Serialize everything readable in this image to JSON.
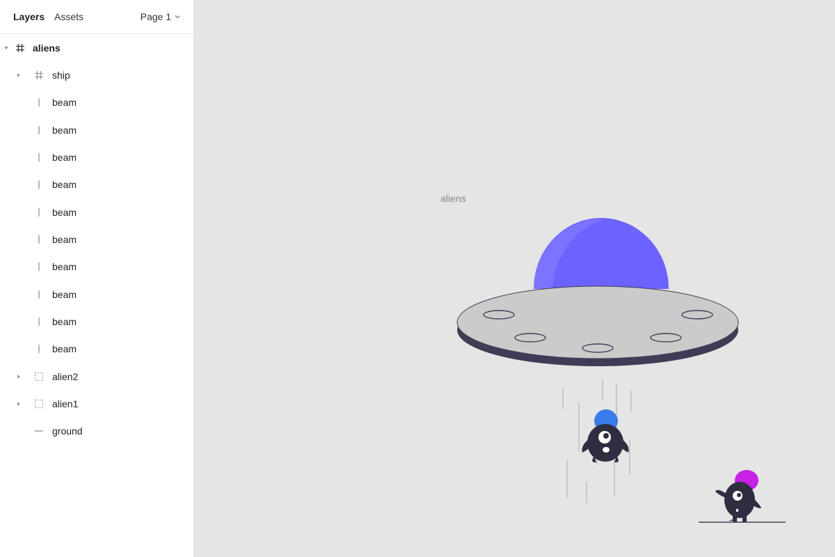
{
  "sidebar": {
    "tabs": [
      {
        "label": "Layers",
        "active": true
      },
      {
        "label": "Assets",
        "active": false
      }
    ],
    "page_selector": {
      "value": "Page 1"
    },
    "layers": [
      {
        "label": "aliens",
        "icon": "frame-hash-icon",
        "expanded": true,
        "bold": true,
        "depth": 0
      },
      {
        "label": "ship",
        "icon": "frame-hash-icon",
        "expanded": false,
        "depth": 1,
        "has_children": true
      },
      {
        "label": "beam",
        "icon": "line-vertical-icon",
        "depth": 1
      },
      {
        "label": "beam",
        "icon": "line-vertical-icon",
        "depth": 1
      },
      {
        "label": "beam",
        "icon": "line-vertical-icon",
        "depth": 1
      },
      {
        "label": "beam",
        "icon": "line-vertical-icon",
        "depth": 1
      },
      {
        "label": "beam",
        "icon": "line-vertical-icon",
        "depth": 1
      },
      {
        "label": "beam",
        "icon": "line-vertical-icon",
        "depth": 1
      },
      {
        "label": "beam",
        "icon": "line-vertical-icon",
        "depth": 1
      },
      {
        "label": "beam",
        "icon": "line-vertical-icon",
        "depth": 1
      },
      {
        "label": "beam",
        "icon": "line-vertical-icon",
        "depth": 1
      },
      {
        "label": "beam",
        "icon": "line-vertical-icon",
        "depth": 1
      },
      {
        "label": "alien2",
        "icon": "group-dashed-icon",
        "expanded": false,
        "depth": 1,
        "has_children": true
      },
      {
        "label": "alien1",
        "icon": "group-dashed-icon",
        "expanded": false,
        "depth": 1,
        "has_children": true
      },
      {
        "label": "ground",
        "icon": "line-horizontal-icon",
        "depth": 1
      }
    ]
  },
  "canvas": {
    "frame_label": "aliens",
    "colors": {
      "background": "#e5e5e5",
      "dome": "#6c63ff",
      "dome_highlight": "#7b74ff",
      "saucer": "#cbcbcb",
      "saucer_rim": "#3f3d56",
      "beam": "#c8c8c8",
      "alien_body": "#2f2e41",
      "alien1_hat": "#3a7bea",
      "alien2_hat": "#c621e5",
      "ground": "#3f3d56"
    }
  }
}
